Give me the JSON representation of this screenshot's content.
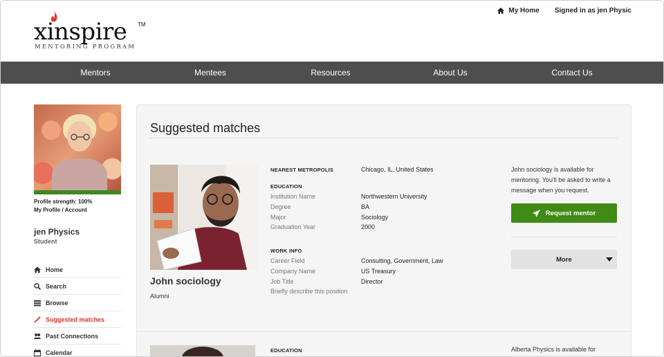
{
  "header": {
    "logo_word": "xinspire",
    "logo_tm": "TM",
    "logo_sub": "MENTORING PROGRAM",
    "my_home": "My Home",
    "signed_in": "Signed in as jen Physic"
  },
  "nav": {
    "items": [
      "Mentors",
      "Mentees",
      "Resources",
      "About Us",
      "Contact Us"
    ]
  },
  "sidebar": {
    "profile_strength": "Profile strength: 100%",
    "my_profile": "My Profile",
    "separator": "/",
    "account": "Account",
    "name": "jen Physics",
    "role": "Student",
    "strength_fraction": 1.0,
    "menu": [
      {
        "label": "Home",
        "icon": "home-icon"
      },
      {
        "label": "Search",
        "icon": "search-icon"
      },
      {
        "label": "Browse",
        "icon": "list-icon"
      },
      {
        "label": "Suggested matches",
        "icon": "magic-wand-icon"
      },
      {
        "label": "Past Connections",
        "icon": "users-icon"
      },
      {
        "label": "Calendar",
        "icon": "calendar-icon"
      }
    ]
  },
  "main": {
    "title": "Suggested matches",
    "match1": {
      "name": "John sociology",
      "role": "Alumni",
      "nearest_metro_label": "NEAREST METROPOLIS",
      "nearest_metro": "Chicago, IL, United States",
      "education_head": "EDUCATION",
      "institution_label": "Institution Name",
      "institution": "Northwestern University",
      "degree_label": "Degree",
      "degree": "BA",
      "major_label": "Major",
      "major": "Sociology",
      "grad_label": "Graduation Year",
      "grad": "2000",
      "work_head": "WORK INFO",
      "career_label": "Career Field",
      "career": "Consulting, Government, Law",
      "company_label": "Company Name",
      "company": "US Treasury",
      "job_label": "Job Title",
      "job": "Director",
      "describe_label": "Briefly describe this position",
      "availability": "John sociology is available for mentoring. You'll be asked to write a message when you request.",
      "request_label": "Request mentor",
      "more_label": "More"
    },
    "match2": {
      "education_head": "EDUCATION",
      "availability": "Alberta Physics is available for"
    }
  },
  "colors": {
    "nav_bg": "#4e4e4e",
    "accent_green": "#3f8b15",
    "active_red": "#d9362b"
  }
}
